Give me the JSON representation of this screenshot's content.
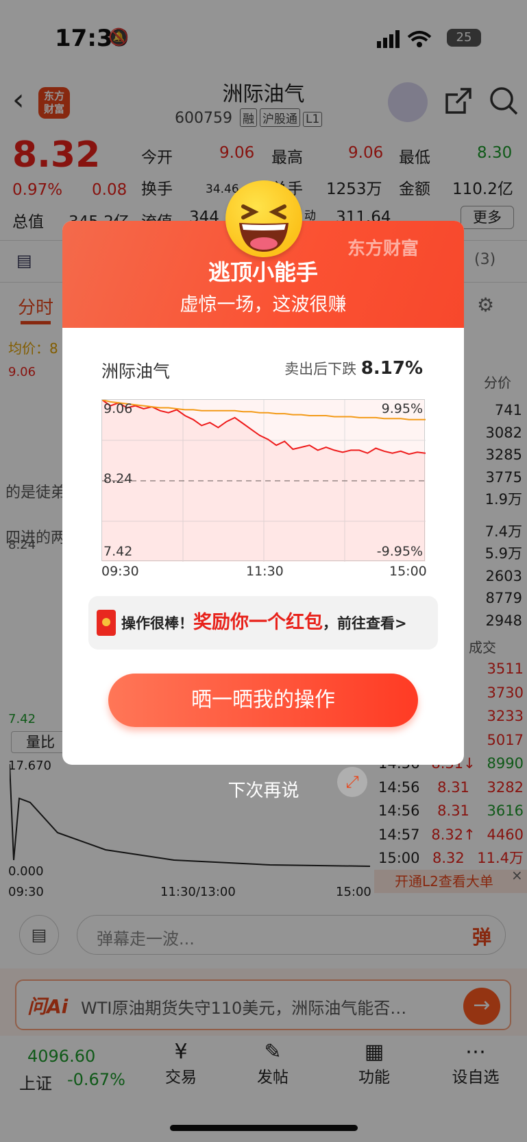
{
  "status": {
    "time": "17:39",
    "battery": "25"
  },
  "header": {
    "title": "洲际油气",
    "code": "600759",
    "tags": [
      "融",
      "沪股通",
      "L1"
    ],
    "logo": "东方\n财富"
  },
  "quote": {
    "price": "8.32",
    "pct": "0.97%",
    "chg": "0.08",
    "r1": [
      {
        "l": "今开",
        "v": "9.06"
      },
      {
        "l": "最高",
        "v": "9.06"
      },
      {
        "l": "最低",
        "v": "8.30"
      }
    ],
    "r2": [
      {
        "l": "换手",
        "v": "34.46"
      },
      {
        "l": "总手",
        "v": "1253万"
      },
      {
        "l": "金额",
        "v": "110.2亿"
      }
    ],
    "r3": [
      {
        "l": "总值",
        "v": "345.2亿"
      },
      {
        "l": "流值",
        "v": "344"
      },
      {
        "l": "动",
        "v": "311.64"
      }
    ],
    "more": "更多"
  },
  "bg": {
    "tab": "分时",
    "avg": "均价：8",
    "count": "(3)",
    "price_hdr": "分价",
    "prices": [
      "741",
      "3082",
      "3285",
      "3775",
      "1.9万",
      "7.4万",
      "5.9万",
      "2603",
      "8779",
      "2948"
    ],
    "trade_hdr": "成交",
    "trades": [
      {
        "t": "",
        "p": "",
        "v": "3511"
      },
      {
        "t": "",
        "p": "",
        "v": "3730"
      },
      {
        "t": "",
        "p": "",
        "v": "3233"
      },
      {
        "t": "",
        "p": "",
        "v": "5017"
      },
      {
        "t": "14:56",
        "p": "8.31↓",
        "v": "8990"
      },
      {
        "t": "14:56",
        "p": "8.31",
        "v": "3282"
      },
      {
        "t": "14:56",
        "p": "8.31",
        "v": "3616"
      },
      {
        "t": "14:57",
        "p": "8.32↑",
        "v": "4460"
      },
      {
        "t": "15:00",
        "p": "8.32",
        "v": "11.4万"
      }
    ],
    "l2": "开通L2查看大单",
    "vol_lbl": "量比",
    "vol_max": "17.670",
    "vol_min": "0.000",
    "times": [
      "09:30",
      "11:30/13:00",
      "15:00"
    ],
    "left_hi": "9.06",
    "left_lo": "7.42",
    "left_mid": "8.24",
    "snippet1": "的是徒弟",
    "snippet2": "四进的两",
    "danmu": "弹幕走一波...",
    "danmu_btn": "弹",
    "ai_logo": "问Ai",
    "ai_text": "WTI原油期货失守110美元，洲际油气能否…",
    "index_val": "4096.60",
    "index_name": "上证",
    "index_pct": "-0.67%",
    "nav": [
      "交易",
      "发帖",
      "功能",
      "设自选"
    ]
  },
  "modal": {
    "watermark": "东方财富",
    "title": "逃顶小能手",
    "subtitle": "虚惊一场，这波很赚",
    "stock": "洲际油气",
    "fall_label": "卖出后下跌",
    "fall_value": "8.17%",
    "promo_a": "操作很棒！",
    "promo_b": "奖励你一个红包",
    "promo_c": "，前往查看>",
    "cta": "晒一晒我的操作",
    "later": "下次再说"
  },
  "chart_data": {
    "type": "line",
    "title": "",
    "x_ticks": [
      "09:30",
      "11:30",
      "15:00"
    ],
    "y_top_left": "9.06",
    "y_mid": "8.24",
    "y_bot_left": "7.42",
    "y_top_right": "9.95%",
    "y_bot_right": "-9.95%",
    "ylim": [
      7.42,
      9.06
    ],
    "series": [
      {
        "values": [
          9.06,
          9.0,
          9.03,
          8.98,
          9.0,
          8.97,
          8.99,
          8.95,
          8.93,
          8.96,
          8.9,
          8.86,
          8.8,
          8.83,
          8.78,
          8.84,
          8.88,
          8.82,
          8.76,
          8.7,
          8.66,
          8.6,
          8.64,
          8.56,
          8.58,
          8.6,
          8.55,
          8.58,
          8.55,
          8.53,
          8.55,
          8.55,
          8.52,
          8.57,
          8.54,
          8.52,
          8.54,
          8.51,
          8.53,
          8.52
        ]
      },
      {
        "values": [
          9.06,
          9.04,
          9.03,
          9.02,
          9.01,
          9.0,
          8.99,
          8.98,
          8.98,
          8.97,
          8.96,
          8.96,
          8.95,
          8.95,
          8.95,
          8.95,
          8.95,
          8.94,
          8.94,
          8.93,
          8.93,
          8.92,
          8.92,
          8.91,
          8.91,
          8.9,
          8.9,
          8.9,
          8.89,
          8.89,
          8.89,
          8.88,
          8.88,
          8.88,
          8.87,
          8.87,
          8.87,
          8.86,
          8.86,
          8.86
        ]
      }
    ]
  }
}
